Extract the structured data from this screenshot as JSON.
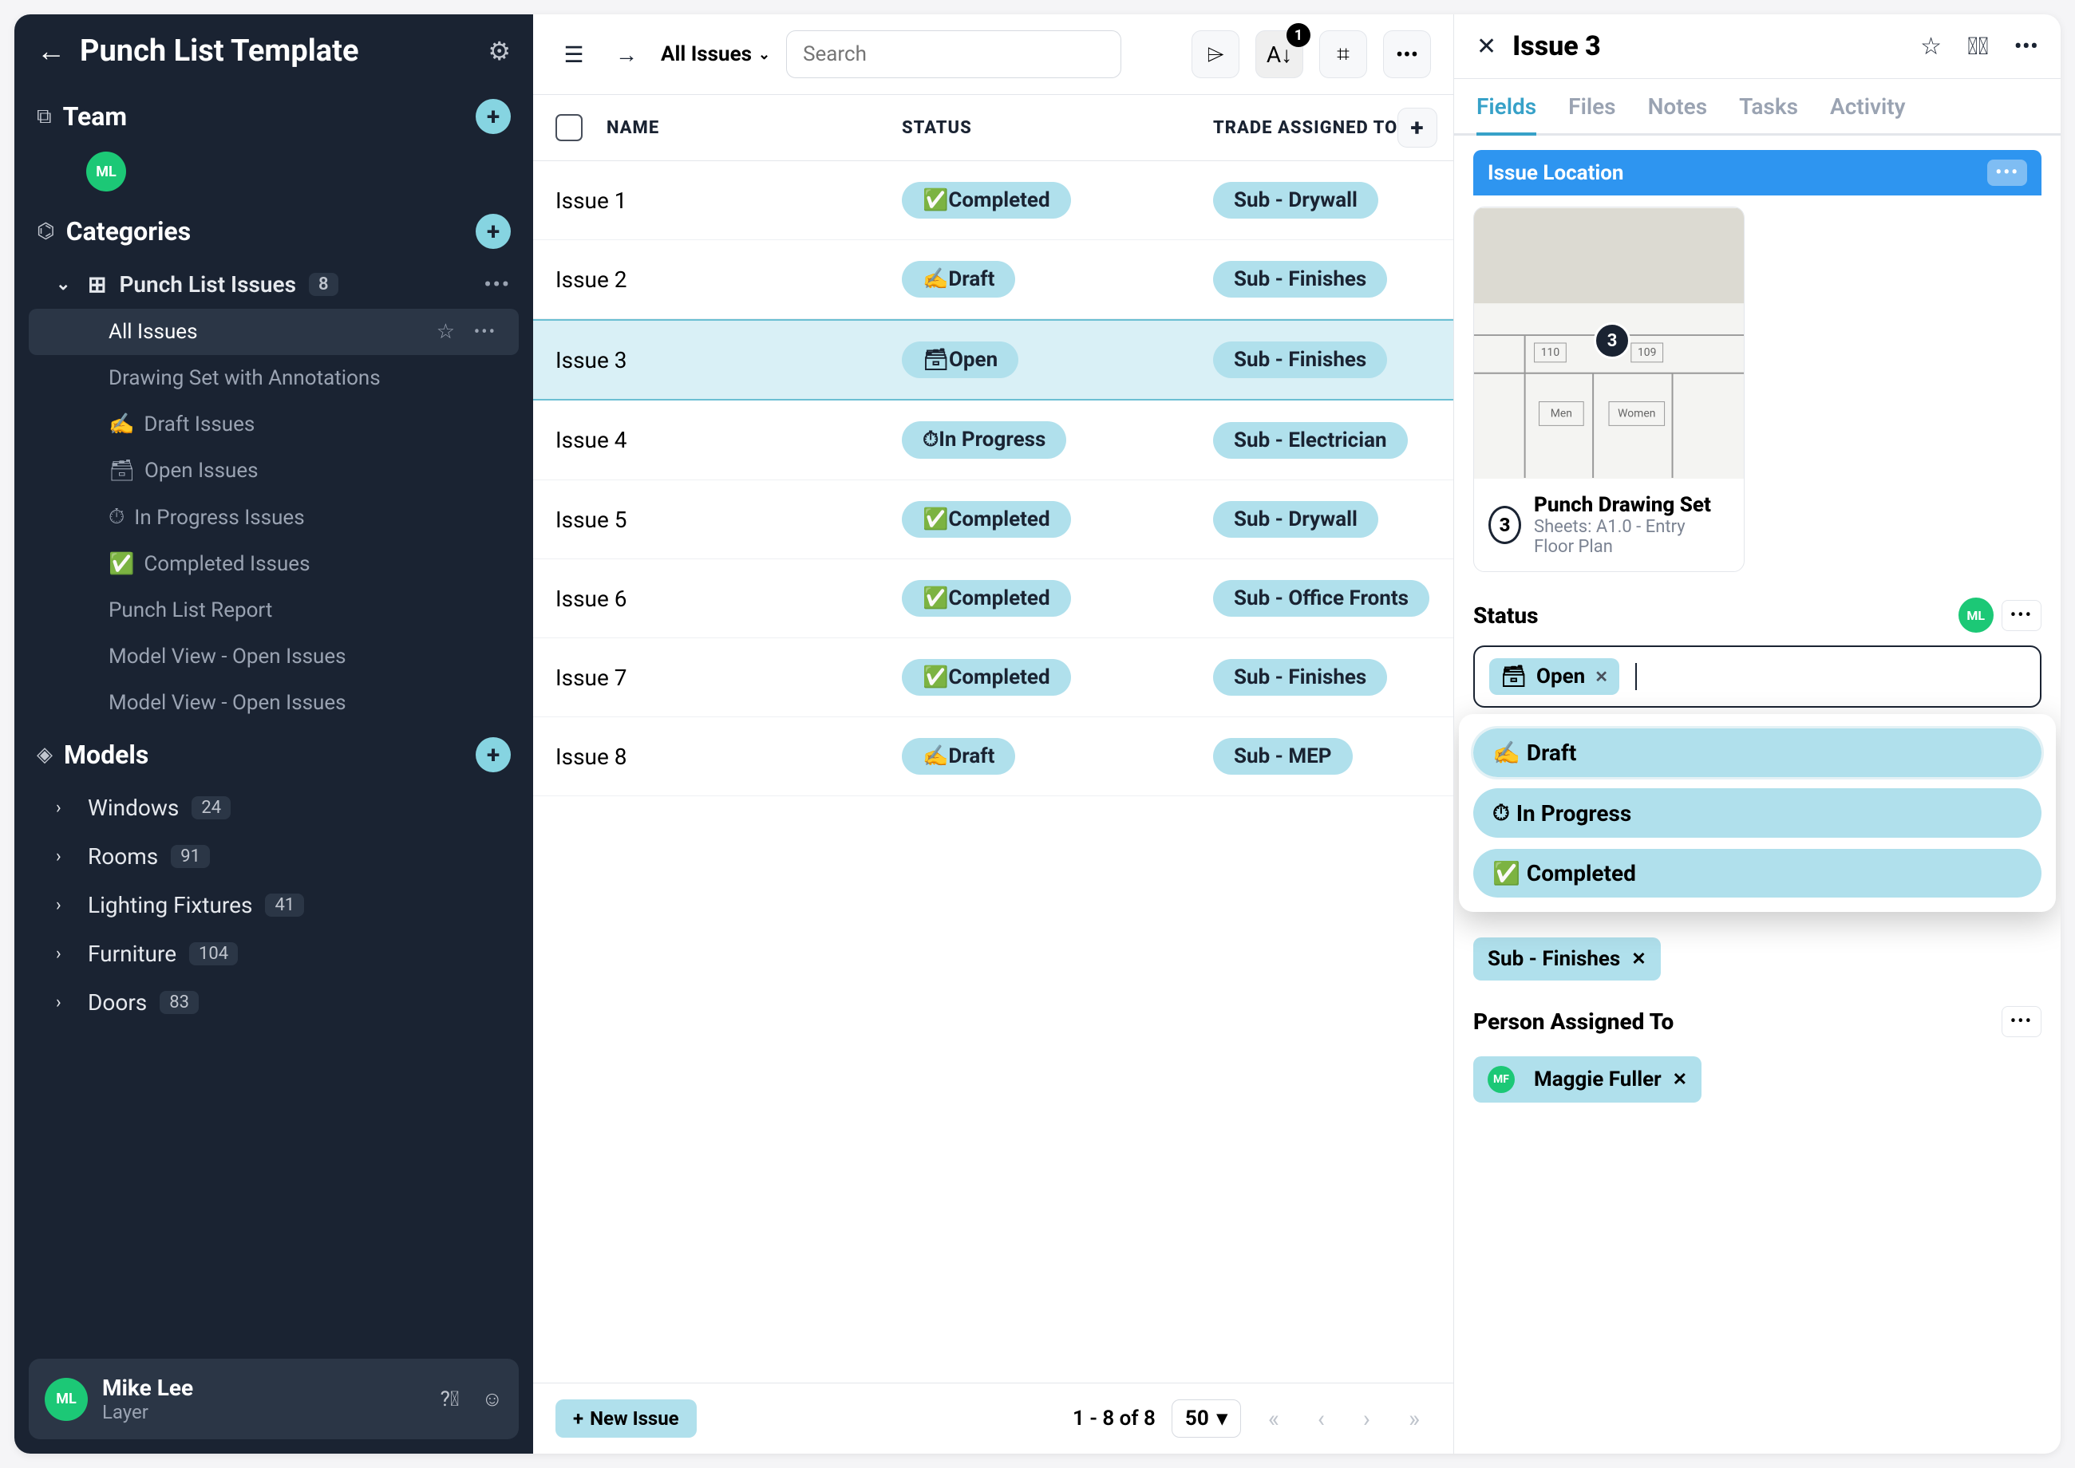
{
  "sidebar": {
    "title": "Punch List Template",
    "team_label": "Team",
    "avatar_initials": "ML",
    "categories_label": "Categories",
    "cat_main": {
      "label": "Punch List Issues",
      "count": "8"
    },
    "subs": [
      {
        "label": "All Issues",
        "active": true
      },
      {
        "label": "Drawing Set with Annotations"
      },
      {
        "label": "Draft Issues",
        "prefix": "✍️"
      },
      {
        "label": "Open Issues",
        "prefix": "🗃"
      },
      {
        "label": "In Progress Issues",
        "prefix": "⏱"
      },
      {
        "label": "Completed Issues",
        "prefix": "✅"
      },
      {
        "label": "Punch List Report"
      },
      {
        "label": "Model View - Open Issues"
      },
      {
        "label": "Model View - Open Issues"
      }
    ],
    "models_label": "Models",
    "models": [
      {
        "label": "Windows",
        "count": "24"
      },
      {
        "label": "Rooms",
        "count": "91"
      },
      {
        "label": "Lighting Fixtures",
        "count": "41"
      },
      {
        "label": "Furniture",
        "count": "104"
      },
      {
        "label": "Doors",
        "count": "83"
      }
    ],
    "user": {
      "name": "Mike Lee",
      "sub": "Layer",
      "initials": "ML"
    }
  },
  "toolbar": {
    "crumb": "All Issues",
    "search_placeholder": "Search",
    "sort_badge": "1"
  },
  "table": {
    "headers": {
      "name": "NAME",
      "status": "STATUS",
      "trade": "TRADE ASSIGNED TO"
    },
    "rows": [
      {
        "name": "Issue 1",
        "status_icon": "✅",
        "status": "Completed",
        "trade": "Sub - Drywall"
      },
      {
        "name": "Issue 2",
        "status_icon": "✍️",
        "status": "Draft",
        "trade": "Sub - Finishes"
      },
      {
        "name": "Issue 3",
        "status_icon": "🗃",
        "status": "Open",
        "trade": "Sub - Finishes",
        "selected": true
      },
      {
        "name": "Issue 4",
        "status_icon": "⏱",
        "status": "In Progress",
        "trade": "Sub - Electrician"
      },
      {
        "name": "Issue 5",
        "status_icon": "✅",
        "status": "Completed",
        "trade": "Sub - Drywall"
      },
      {
        "name": "Issue 6",
        "status_icon": "✅",
        "status": "Completed",
        "trade": "Sub - Office Fronts"
      },
      {
        "name": "Issue 7",
        "status_icon": "✅",
        "status": "Completed",
        "trade": "Sub - Finishes"
      },
      {
        "name": "Issue 8",
        "status_icon": "✍️",
        "status": "Draft",
        "trade": "Sub - MEP"
      }
    ]
  },
  "footer": {
    "new_label": "New Issue",
    "page_text": "1 - 8 of 8",
    "page_size": "50"
  },
  "detail": {
    "title": "Issue 3",
    "tabs": [
      "Fields",
      "Files",
      "Notes",
      "Tasks",
      "Activity"
    ],
    "location_label": "Issue Location",
    "location": {
      "pin": "3",
      "num": "3",
      "title": "Punch Drawing Set",
      "sub": "Sheets: A1.0 - Entry Floor Plan"
    },
    "status_label": "Status",
    "status_avatar": "ML",
    "status_value_icon": "🗃",
    "status_value": "Open",
    "status_options": [
      {
        "icon": "✍️",
        "label": "Draft"
      },
      {
        "icon": "⏱",
        "label": "In Progress"
      },
      {
        "icon": "✅",
        "label": "Completed"
      }
    ],
    "trade_value": "Sub - Finishes",
    "person_label": "Person Assigned To",
    "person_initials": "MF",
    "person_value": "Maggie Fuller"
  }
}
